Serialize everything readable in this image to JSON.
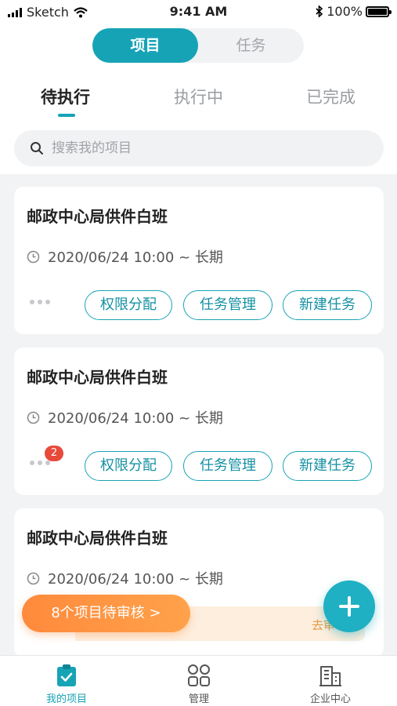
{
  "status_bar": {
    "carrier": "Sketch",
    "time": "9:41 AM",
    "battery": "100%"
  },
  "segment": {
    "active": "项目",
    "inactive": "任务"
  },
  "tabs": [
    {
      "label": "待执行"
    },
    {
      "label": "执行中"
    },
    {
      "label": "已完成"
    }
  ],
  "search": {
    "placeholder": "搜索我的项目"
  },
  "cards": [
    {
      "title": "邮政中心局供件白班",
      "time": "2020/06/24 10:00 ~ 长期",
      "badge": "",
      "actions": [
        "权限分配",
        "任务管理",
        "新建任务"
      ]
    },
    {
      "title": "邮政中心局供件白班",
      "time": "2020/06/24 10:00 ~ 长期",
      "badge": "2",
      "actions": [
        "权限分配",
        "任务管理",
        "新建任务"
      ]
    },
    {
      "title": "邮政中心局供件白班",
      "time": "2020/06/24 10:00 ~ 长期",
      "badge": "",
      "actions": []
    }
  ],
  "review": {
    "pill": "8个项目待审核 >",
    "link": "去审"
  },
  "bottom_nav": [
    {
      "label": "我的项目",
      "icon": "clipboard-check-icon"
    },
    {
      "label": "管理",
      "icon": "grid-icon"
    },
    {
      "label": "企业中心",
      "icon": "building-icon"
    }
  ],
  "colors": {
    "accent": "#17a3b6",
    "orange": "#ff8a3d",
    "badge": "#e74a3b"
  }
}
